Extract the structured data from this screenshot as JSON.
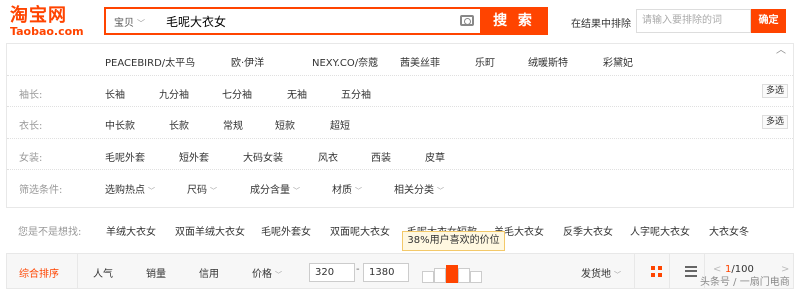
{
  "header": {
    "logo_cn": "淘宝网",
    "logo_en": "Taobao.com",
    "search_type": "宝贝",
    "search_query": "毛呢大衣女",
    "search_button": "搜 索",
    "in_results_label": "在结果中排除",
    "in_results_placeholder": "请输入要排除的词",
    "confirm_button": "确定"
  },
  "filters": {
    "brands": [
      "PEACEBIRD/太平鸟",
      "欧·伊洋",
      "NEXY.CO/奈蔻",
      "茜美丝菲",
      "乐町",
      "绒暖斯特",
      "彩黛妃"
    ],
    "sleeve": {
      "label": "袖长:",
      "options": [
        "长袖",
        "九分袖",
        "七分袖",
        "无袖",
        "五分袖"
      ],
      "more": "多选"
    },
    "length": {
      "label": "衣长:",
      "options": [
        "中长款",
        "长款",
        "常规",
        "短款",
        "超短"
      ],
      "more": "多选"
    },
    "womens": {
      "label": "女装:",
      "options": [
        "毛呢外套",
        "短外套",
        "大码女装",
        "风衣",
        "西装",
        "皮草"
      ]
    },
    "conditions": {
      "label": "筛选条件:",
      "options": [
        "选购热点",
        "尺码",
        "成分含量",
        "材质",
        "相关分类"
      ]
    }
  },
  "suggest": {
    "label": "您是不是想找:",
    "items": [
      "羊绒大衣女",
      "双面羊绒大衣女",
      "毛呢外套女",
      "双面呢大衣女",
      "毛呢大衣女短款",
      "羊毛大衣女",
      "反季大衣女",
      "人字呢大衣女",
      "大衣女冬"
    ]
  },
  "tooltip": "38%用户喜欢的价位",
  "sortbar": {
    "items": [
      "综合排序",
      "人气",
      "销量",
      "信用",
      "价格"
    ],
    "price_min": "320",
    "price_max": "1380",
    "price_dash": "-",
    "ship_from": "发货地",
    "page_current": "1",
    "page_total": "/100",
    "accent": "#ff4400"
  },
  "watermark": "头条号 / 一扇门电商"
}
